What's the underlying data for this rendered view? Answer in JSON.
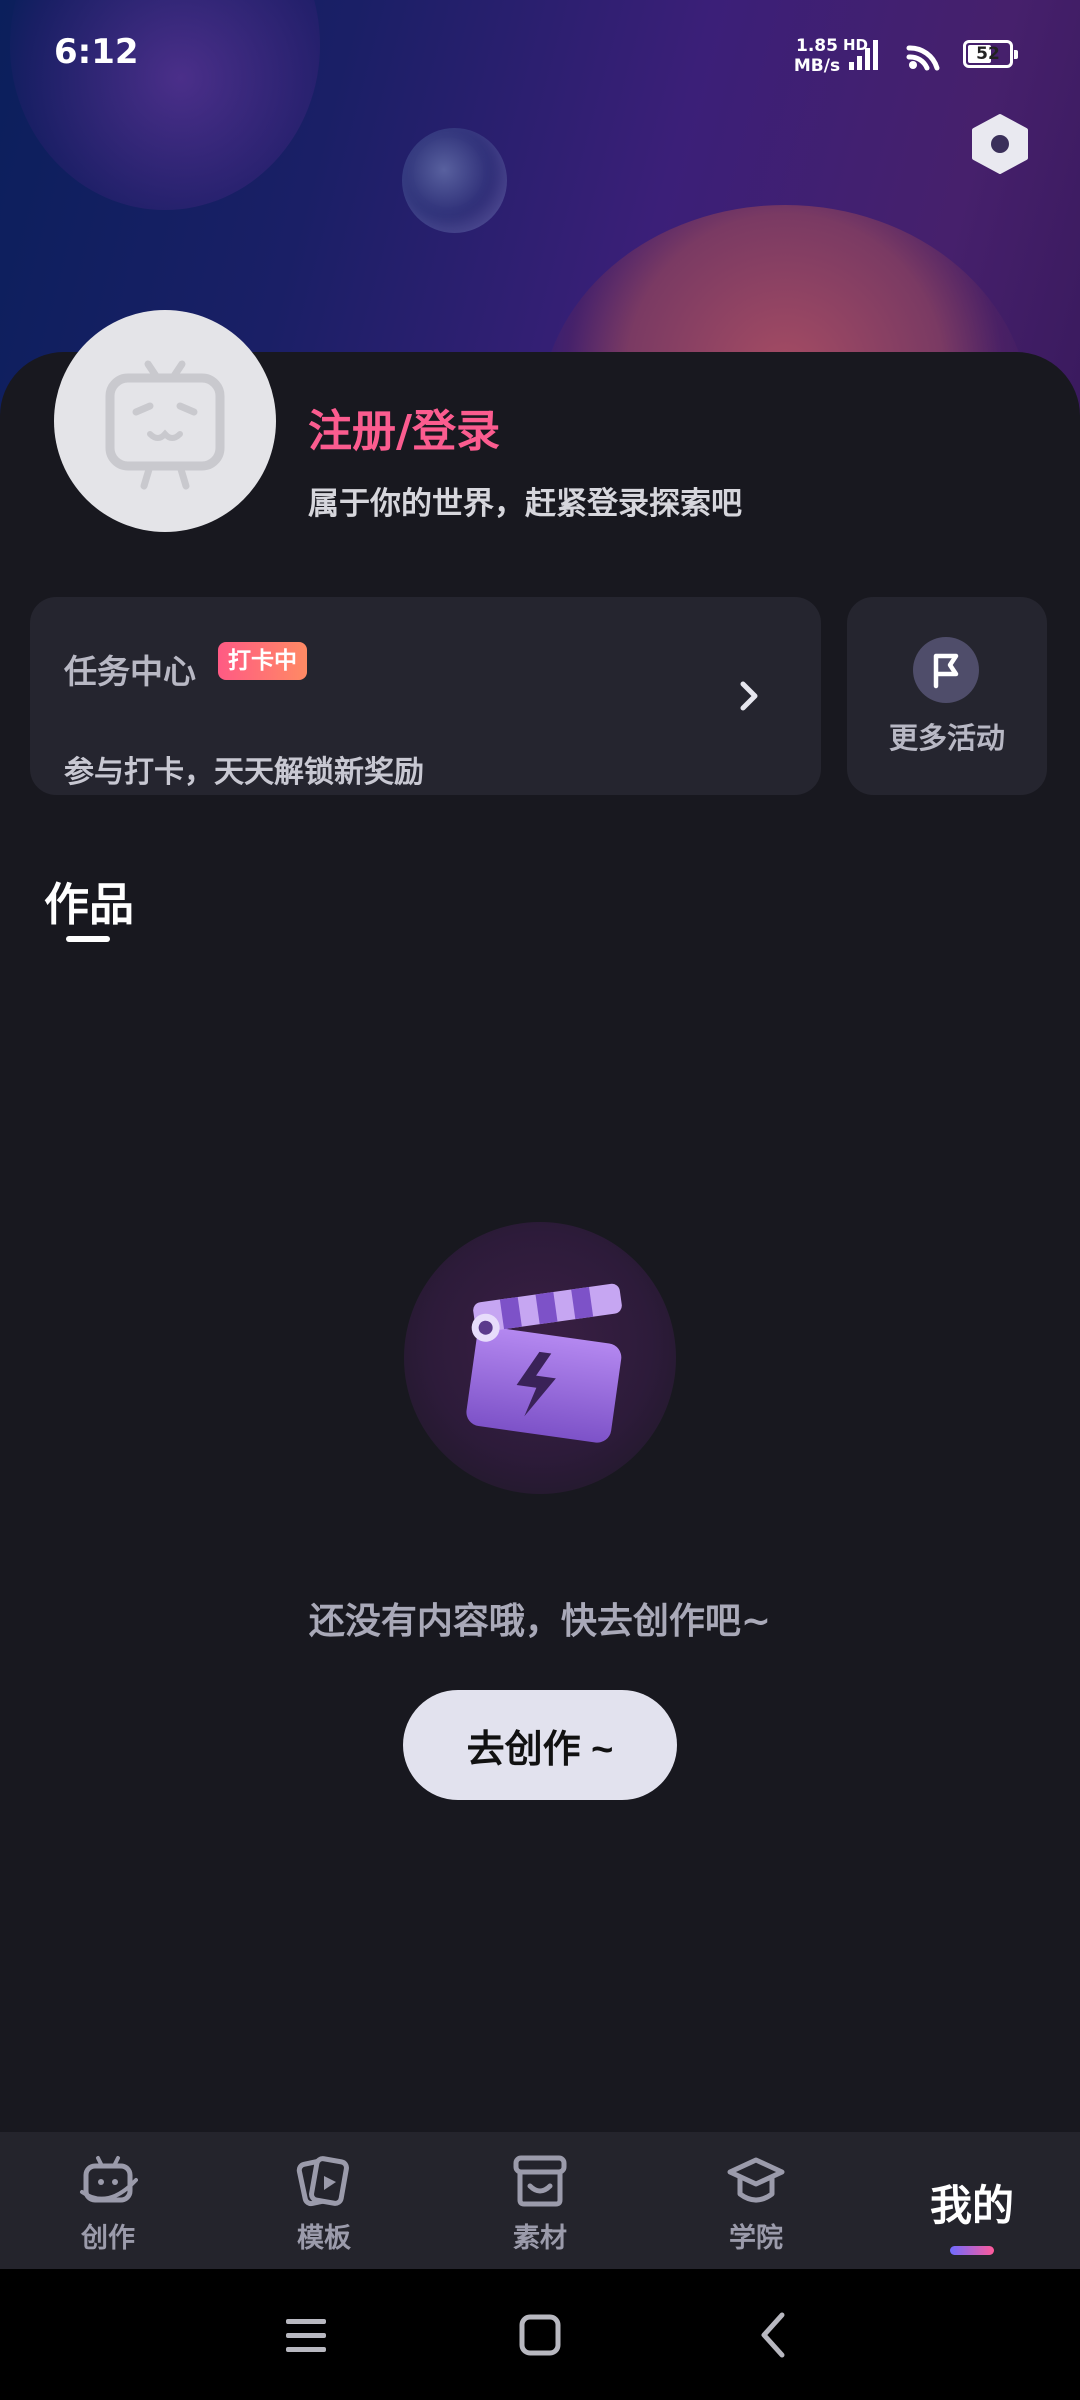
{
  "status_bar": {
    "time": "6:12",
    "net_speed_value": "1.85",
    "net_speed_unit": "MB/s",
    "network_label": "HD",
    "battery_level": "52"
  },
  "header": {
    "settings_icon": "hexagon-settings-icon"
  },
  "profile": {
    "avatar_icon": "tv-mascot-placeholder-icon",
    "login_title": "注册/登录",
    "login_subtitle": "属于你的世界，赶紧登录探索吧"
  },
  "task_center": {
    "title": "任务中心",
    "badge": "打卡中",
    "scroll_text": "参与打卡，天天解锁新奖励"
  },
  "more_activities": {
    "label": "更多活动",
    "icon": "flag-icon"
  },
  "works": {
    "tab_label": "作品",
    "empty_text": "还没有内容哦，快去创作吧~",
    "create_button": "去创作 ~",
    "illustration_icon": "clapperboard-icon"
  },
  "bottom_nav": {
    "items": [
      {
        "label": "创作",
        "icon": "tv-create-icon"
      },
      {
        "label": "模板",
        "icon": "template-cards-icon"
      },
      {
        "label": "素材",
        "icon": "store-icon"
      },
      {
        "label": "学院",
        "icon": "graduation-cap-icon"
      },
      {
        "label": "我的",
        "icon": ""
      }
    ],
    "active_index": 4
  },
  "colors": {
    "accent_pink": "#fb5c8f",
    "background": "#18181f",
    "card": "#25252f"
  }
}
